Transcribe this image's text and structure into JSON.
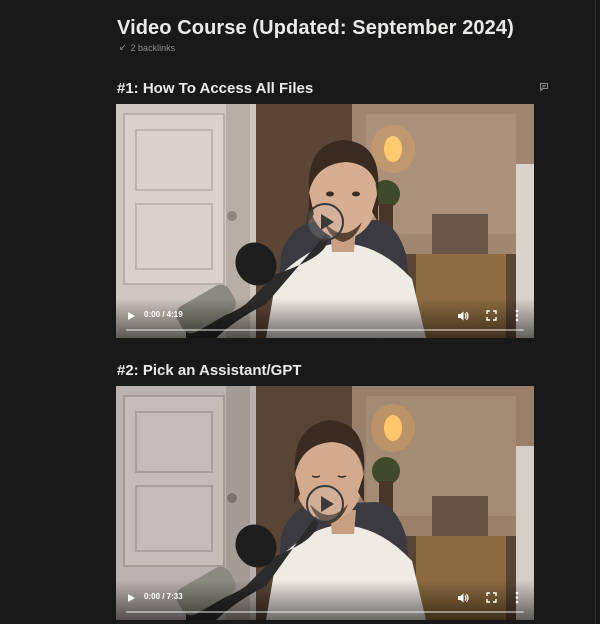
{
  "page": {
    "title": "Video Course (Updated: September 2024)",
    "backlinks_label": "2 backlinks",
    "backlinks_icon": "arrow-down-left-icon",
    "comment_icon": "comment-icon"
  },
  "videos": [
    {
      "heading": "#1: How To Access All Files",
      "time": "0:00 / 4:19",
      "progress": 0
    },
    {
      "heading": "#2: Pick an Assistant/GPT",
      "time": "0:00 / 7:33",
      "progress": 0
    }
  ],
  "colors": {
    "background": "#191919",
    "text": "#e9e9e7",
    "muted": "#8d8d8a"
  }
}
